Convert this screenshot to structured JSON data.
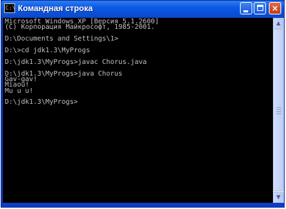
{
  "window": {
    "title": "Командная строка",
    "icon_name": "cmd-icon",
    "icon_text": "C:\\",
    "controls": {
      "minimize": "minimize",
      "maximize": "maximize",
      "close": "×"
    }
  },
  "console": {
    "lines": [
      "Microsoft Windows XP [Версия 5.1.2600]",
      "(С) Корпорация Майкрософт, 1985-2001.",
      "",
      "D:\\Documents and Settings\\1>",
      "",
      "D:\\>cd jdk1.3\\MyProgs",
      "",
      "D:\\jdk1.3\\MyProgs>javac Chorus.java",
      "",
      "D:\\jdk1.3\\MyProgs>java Chorus",
      "Gav-gav!",
      "Miaou!",
      "Mu u u!",
      "",
      "D:\\jdk1.3\\MyProgs>"
    ],
    "text_color": "#c0c0c0",
    "background": "#000000"
  },
  "scrollbar": {
    "up_arrow": "▲",
    "down_arrow": "▼"
  },
  "colors": {
    "titlebar": "#0c5ae3",
    "close_button": "#c23a18"
  }
}
